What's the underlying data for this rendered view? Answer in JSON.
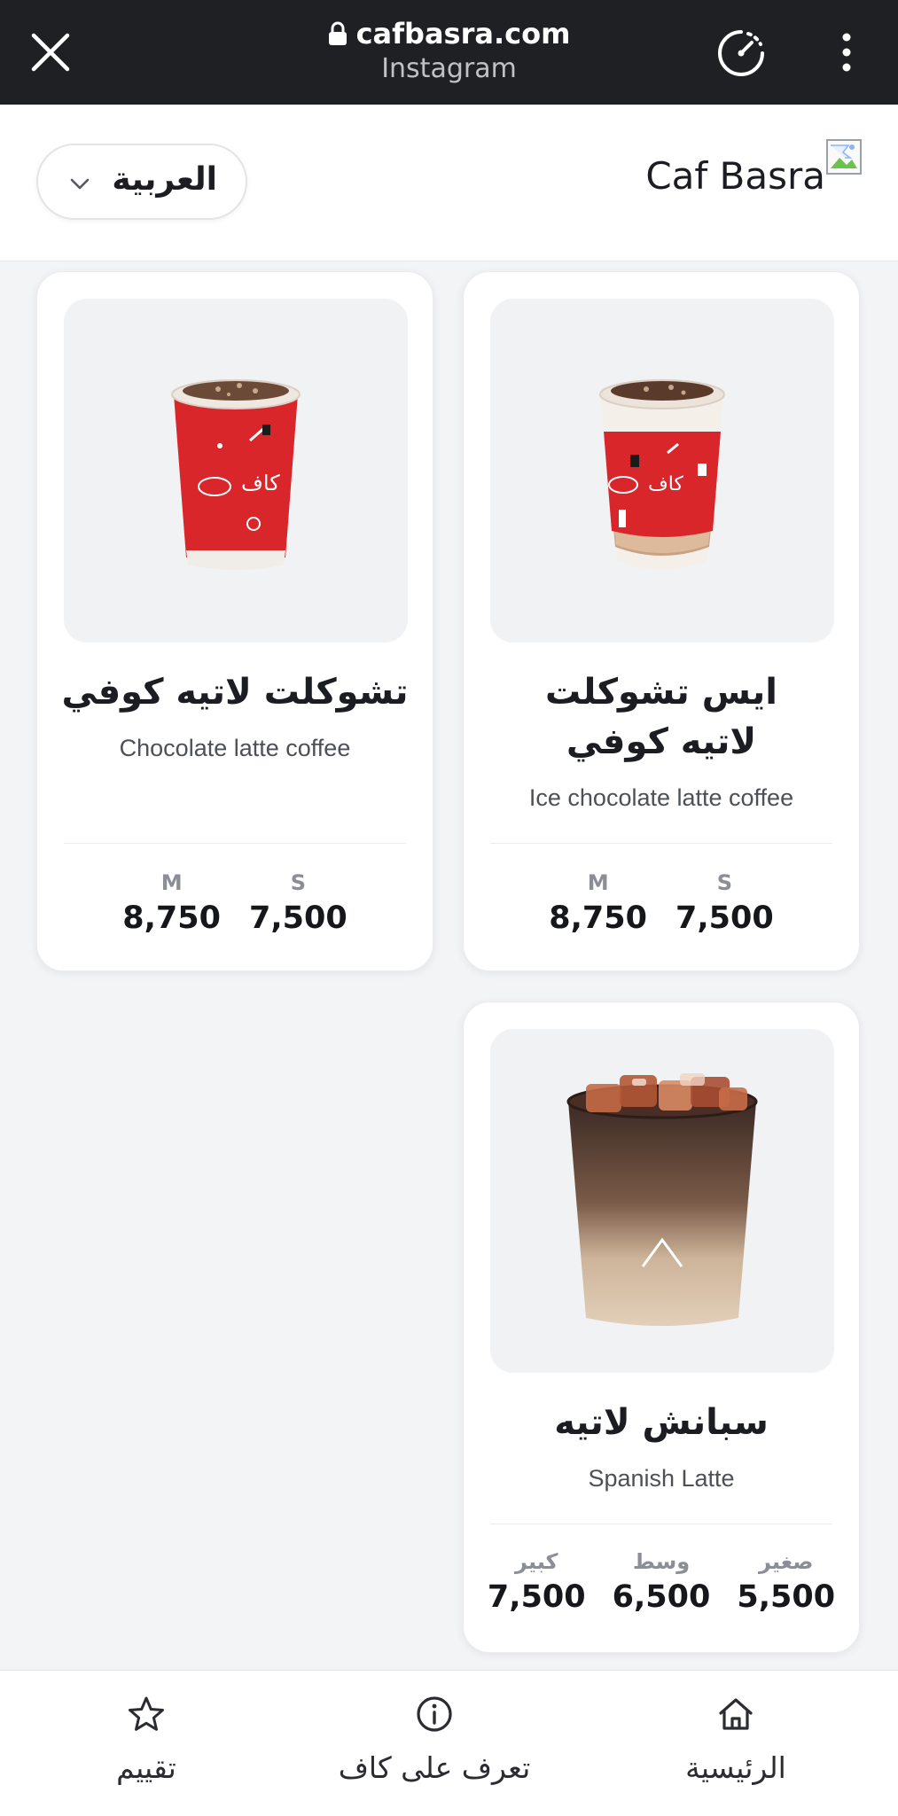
{
  "browser": {
    "url": "cafbasra.com",
    "source": "Instagram",
    "icons": [
      "close-icon",
      "lock-icon",
      "speedometer-icon",
      "more-vertical-icon"
    ]
  },
  "header": {
    "language_label": "العربية",
    "brand_name": "Caf Basra"
  },
  "products": [
    {
      "title": "ايس تشوكلت لاتيه كوفي",
      "subtitle": "Ice chocolate latte coffee",
      "prices": [
        {
          "size": "S",
          "value": "7,500"
        },
        {
          "size": "M",
          "value": "8,750"
        }
      ]
    },
    {
      "title": "تشوكلت لاتيه كوفي",
      "subtitle": "Chocolate latte coffee",
      "prices": [
        {
          "size": "S",
          "value": "7,500"
        },
        {
          "size": "M",
          "value": "8,750"
        }
      ]
    },
    {
      "title": "سبانش لاتيه",
      "subtitle": "Spanish Latte",
      "prices": [
        {
          "size": "صغير",
          "value": "5,500"
        },
        {
          "size": "وسط",
          "value": "6,500"
        },
        {
          "size": "كبير",
          "value": "7,500"
        }
      ]
    }
  ],
  "bottom_nav": [
    {
      "label": "الرئيسية",
      "icon": "home-icon"
    },
    {
      "label": "تعرف على كاف",
      "icon": "info-icon"
    },
    {
      "label": "تقييم",
      "icon": "star-icon"
    }
  ],
  "colors": {
    "chrome_bg": "#1f2023",
    "page_bg": "#f3f4f6",
    "cup_red": "#d8262b"
  }
}
